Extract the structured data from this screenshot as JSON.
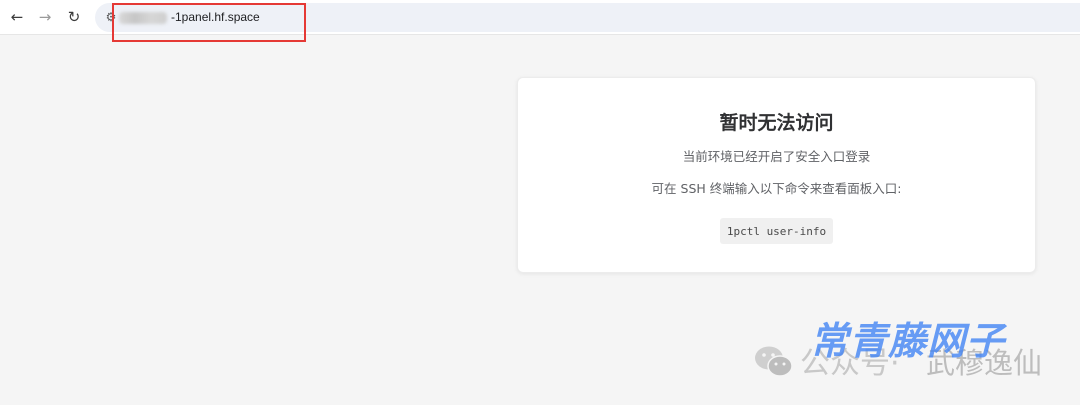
{
  "browser": {
    "back_icon": "←",
    "forward_icon": "→",
    "reload_icon": "↻",
    "site_info_icon": "⚙",
    "url_visible": "-1panel.hf.space"
  },
  "page": {
    "title": "暂时无法访问",
    "line1": "当前环境已经开启了安全入口登录",
    "line2": "可在 SSH 终端输入以下命令来查看面板入口:",
    "command": "1pctl user-info"
  },
  "watermark": {
    "prefix": "公众号·",
    "name": "武穆逸仙",
    "stamp": "常青藤网子"
  },
  "colors": {
    "highlight": "#e53935",
    "background": "#f5f5f5",
    "stamp": "#4285f4"
  }
}
